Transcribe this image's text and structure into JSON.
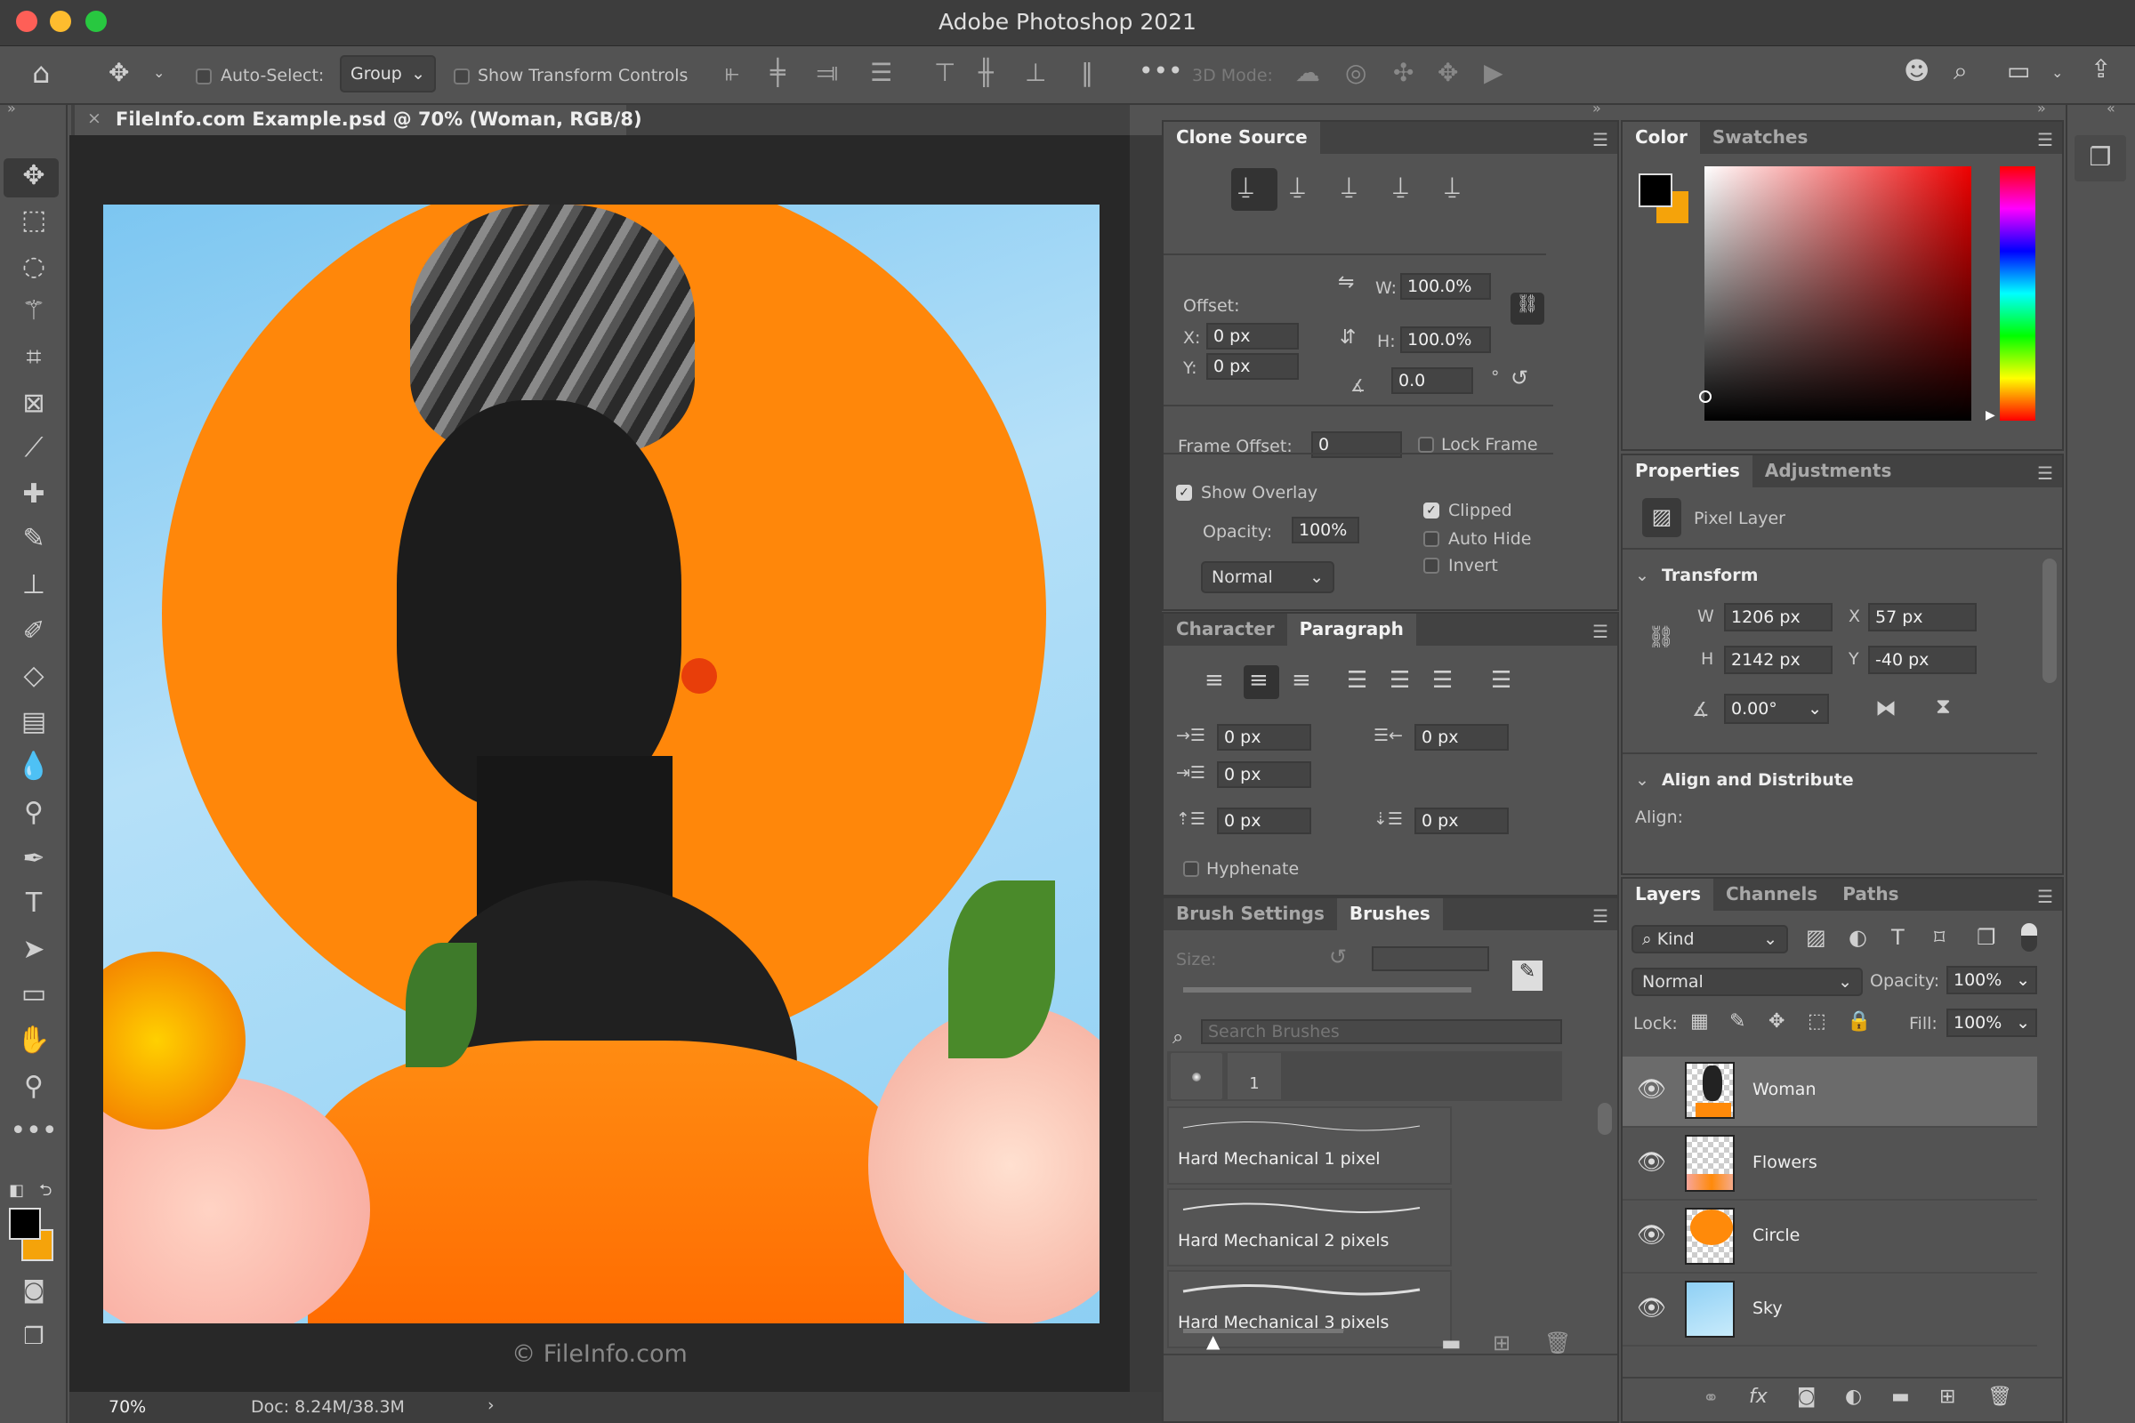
{
  "app": {
    "title": "Adobe Photoshop 2021"
  },
  "options_bar": {
    "auto_select_label": "Auto-Select:",
    "auto_select_value": "Group",
    "show_transform_label": "Show Transform Controls",
    "mode_3d_label": "3D Mode:",
    "more_icon": "ellipsis-icon"
  },
  "document": {
    "tab_title": "FileInfo.com Example.psd @ 70% (Woman, RGB/8)",
    "watermark": "© FileInfo.com",
    "zoom": "70%",
    "doc_size": "Doc: 8.24M/38.3M"
  },
  "clone_source": {
    "tab": "Clone Source",
    "offset_label": "Offset:",
    "x_label": "X:",
    "x": "0 px",
    "y_label": "Y:",
    "y": "0 px",
    "w_label": "W:",
    "w": "100.0%",
    "h_label": "H:",
    "h": "100.0%",
    "angle": "0.0",
    "degree": "°",
    "frame_offset_label": "Frame Offset:",
    "frame_offset": "0",
    "lock_frame": "Lock Frame",
    "show_overlay": "Show Overlay",
    "opacity_label": "Opacity:",
    "opacity": "100%",
    "blend": "Normal",
    "clipped": "Clipped",
    "auto_hide": "Auto Hide",
    "invert": "Invert"
  },
  "paragraph": {
    "tabs": [
      "Character",
      "Paragraph"
    ],
    "indent_left": "0 px",
    "indent_right": "0 px",
    "indent_first": "0 px",
    "space_before": "0 px",
    "space_after": "0 px",
    "hyphenate": "Hyphenate"
  },
  "brushes": {
    "tabs": [
      "Brush Settings",
      "Brushes"
    ],
    "size_label": "Size:",
    "search_placeholder": "Search Brushes",
    "tip_size": "1",
    "items": [
      "Hard Mechanical 1 pixel",
      "Hard Mechanical 2 pixels",
      "Hard Mechanical 3 pixels"
    ]
  },
  "color": {
    "tabs": [
      "Color",
      "Swatches"
    ],
    "foreground": "#000000",
    "background": "#f5a30a"
  },
  "properties": {
    "tabs": [
      "Properties",
      "Adjustments"
    ],
    "kind": "Pixel Layer",
    "transform_title": "Transform",
    "w_label": "W",
    "w": "1206 px",
    "h_label": "H",
    "h": "2142 px",
    "x_label": "X",
    "x": "57 px",
    "y_label": "Y",
    "y": "-40 px",
    "angle": "0.00°",
    "align_title": "Align and Distribute",
    "align_label": "Align:"
  },
  "layers": {
    "tabs": [
      "Layers",
      "Channels",
      "Paths"
    ],
    "filter": "Kind",
    "blend": "Normal",
    "opacity_label": "Opacity:",
    "opacity": "100%",
    "lock_label": "Lock:",
    "fill_label": "Fill:",
    "fill": "100%",
    "items": [
      {
        "name": "Woman",
        "selected": true
      },
      {
        "name": "Flowers"
      },
      {
        "name": "Circle"
      },
      {
        "name": "Sky"
      }
    ]
  },
  "colors": {
    "accent_orange": "#ff8a0a",
    "sky": "#8fd0f5"
  }
}
